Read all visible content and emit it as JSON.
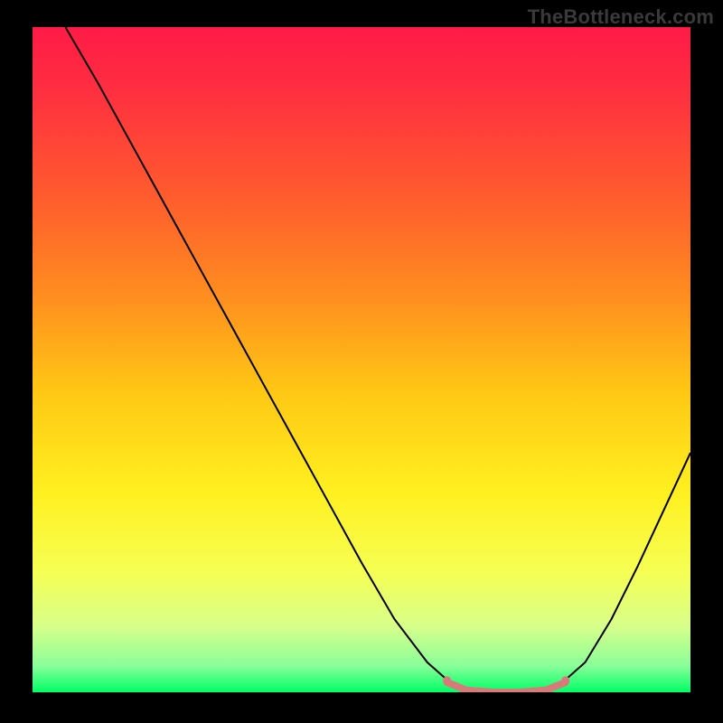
{
  "watermark": "TheBottleneck.com",
  "chart_data": {
    "type": "line",
    "title": "",
    "xlabel": "",
    "ylabel": "",
    "xlim": [
      0,
      100
    ],
    "ylim": [
      0,
      100
    ],
    "background_gradient": {
      "stops": [
        {
          "offset": 0.0,
          "color": "#ff1a47"
        },
        {
          "offset": 0.1,
          "color": "#ff3040"
        },
        {
          "offset": 0.25,
          "color": "#ff5a2e"
        },
        {
          "offset": 0.4,
          "color": "#ff8c20"
        },
        {
          "offset": 0.55,
          "color": "#ffc814"
        },
        {
          "offset": 0.7,
          "color": "#fff020"
        },
        {
          "offset": 0.82,
          "color": "#f6ff54"
        },
        {
          "offset": 0.9,
          "color": "#d8ff8a"
        },
        {
          "offset": 0.96,
          "color": "#8aff9a"
        },
        {
          "offset": 1.0,
          "color": "#00ff66"
        }
      ]
    },
    "series": [
      {
        "name": "bottleneck-curve",
        "stroke": "#000000",
        "stroke_width": 2,
        "points": [
          {
            "x": 5.0,
            "y": 100.0
          },
          {
            "x": 10.0,
            "y": 91.5
          },
          {
            "x": 15.0,
            "y": 82.5
          },
          {
            "x": 20.0,
            "y": 73.5
          },
          {
            "x": 25.0,
            "y": 64.5
          },
          {
            "x": 30.0,
            "y": 55.5
          },
          {
            "x": 35.0,
            "y": 46.5
          },
          {
            "x": 40.0,
            "y": 37.5
          },
          {
            "x": 45.0,
            "y": 28.5
          },
          {
            "x": 50.0,
            "y": 19.5
          },
          {
            "x": 55.0,
            "y": 11.0
          },
          {
            "x": 60.0,
            "y": 4.5
          },
          {
            "x": 64.0,
            "y": 1.0
          },
          {
            "x": 68.0,
            "y": 0.0
          },
          {
            "x": 72.0,
            "y": 0.0
          },
          {
            "x": 76.0,
            "y": 0.0
          },
          {
            "x": 80.0,
            "y": 1.0
          },
          {
            "x": 84.0,
            "y": 4.5
          },
          {
            "x": 88.0,
            "y": 11.0
          },
          {
            "x": 92.0,
            "y": 19.0
          },
          {
            "x": 96.0,
            "y": 27.5
          },
          {
            "x": 100.0,
            "y": 36.0
          }
        ]
      },
      {
        "name": "highlight-band",
        "stroke": "#d97a7a",
        "stroke_width": 8,
        "points": [
          {
            "x": 63.0,
            "y": 1.5
          },
          {
            "x": 66.0,
            "y": 0.3
          },
          {
            "x": 70.0,
            "y": 0.0
          },
          {
            "x": 74.0,
            "y": 0.0
          },
          {
            "x": 78.0,
            "y": 0.3
          },
          {
            "x": 81.0,
            "y": 1.5
          }
        ]
      }
    ],
    "highlight_endpoints": [
      {
        "x": 63.0,
        "y": 1.8,
        "r": 4.5,
        "color": "#d97a7a"
      },
      {
        "x": 81.0,
        "y": 1.8,
        "r": 4.5,
        "color": "#d97a7a"
      }
    ]
  }
}
